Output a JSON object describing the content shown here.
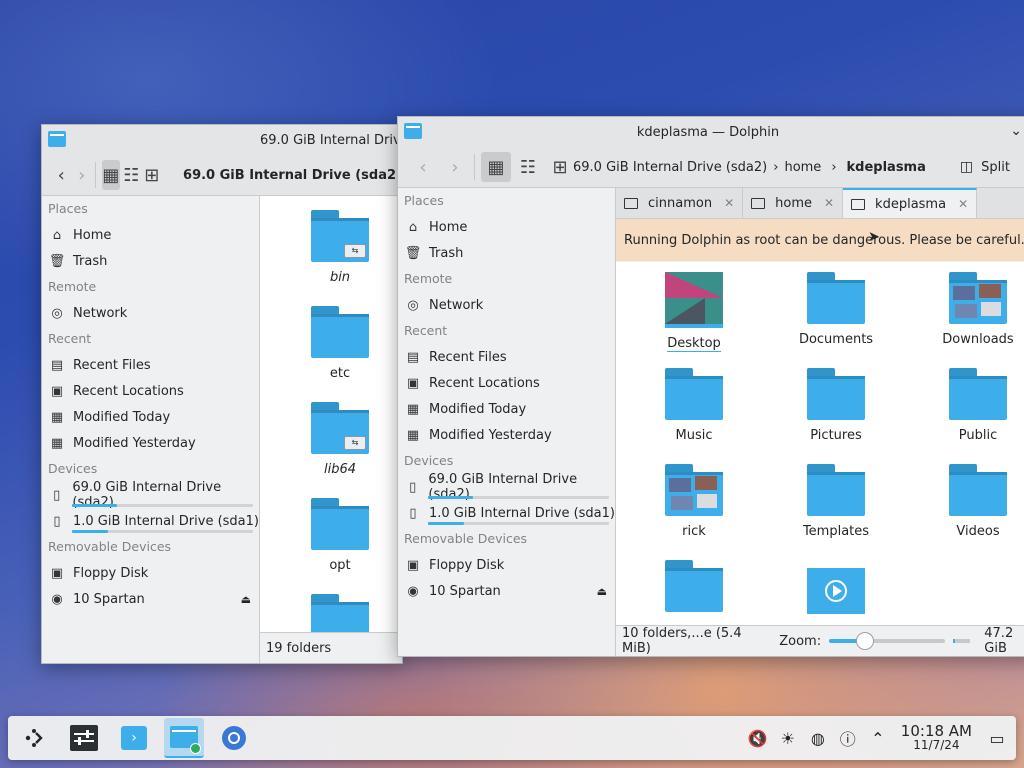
{
  "window_back": {
    "title": "69.0 GiB Internal Drive (sda2) — Dolphin",
    "breadcrumb": "69.0 GiB Internal Drive (sda2)",
    "status": "19 folders",
    "files": [
      {
        "name": "bin",
        "italic": true,
        "badge": true
      },
      {
        "name": "etc",
        "italic": false,
        "badge": false
      },
      {
        "name": "lib64",
        "italic": true,
        "badge": true
      },
      {
        "name": "opt",
        "italic": false,
        "badge": false
      }
    ]
  },
  "sidebar": {
    "places_header": "Places",
    "home": "Home",
    "trash": "Trash",
    "remote_header": "Remote",
    "network": "Network",
    "recent_header": "Recent",
    "recent_files": "Recent Files",
    "recent_locations": "Recent Locations",
    "modified_today": "Modified Today",
    "modified_yesterday": "Modified Yesterday",
    "devices_header": "Devices",
    "drive_sda2": "69.0 GiB Internal Drive (sda2)",
    "drive_sda2_usage": 0.25,
    "drive_sda1": "1.0 GiB Internal Drive (sda1)",
    "drive_sda1_usage": 0.2,
    "removable_header": "Removable Devices",
    "floppy": "Floppy Disk",
    "spartan": "10 Spartan"
  },
  "window_front": {
    "title": "kdeplasma — Dolphin",
    "breadcrumb": {
      "drive": "69.0 GiB Internal Drive (sda2)",
      "home": "home",
      "current": "kdeplasma"
    },
    "split_label": "Split",
    "tabs": [
      {
        "label": "cinnamon",
        "active": false
      },
      {
        "label": "home",
        "active": false
      },
      {
        "label": "kdeplasma",
        "active": true
      }
    ],
    "warning": "Running Dolphin as root can be dangerous. Please be careful.",
    "files": [
      {
        "name": "Desktop",
        "kind": "desktop"
      },
      {
        "name": "Documents",
        "kind": "folder"
      },
      {
        "name": "Downloads",
        "kind": "thumb"
      },
      {
        "name": "Music",
        "kind": "folder"
      },
      {
        "name": "Pictures",
        "kind": "folder"
      },
      {
        "name": "Public",
        "kind": "folder"
      },
      {
        "name": "rick",
        "kind": "thumb2"
      },
      {
        "name": "Templates",
        "kind": "folder"
      },
      {
        "name": "Videos",
        "kind": "folder"
      }
    ],
    "status": "10 folders,...e (5.4 MiB)",
    "zoom_label": "Zoom:",
    "free_space": "47.2 GiB",
    "zoom_level": 0.3,
    "free_space_fraction": 0.15
  },
  "taskbar": {
    "time": "10:18 AM",
    "date": "11/7/24"
  },
  "colors": {
    "accent": "#3daee9",
    "warning_bg": "#f6dcc3"
  }
}
